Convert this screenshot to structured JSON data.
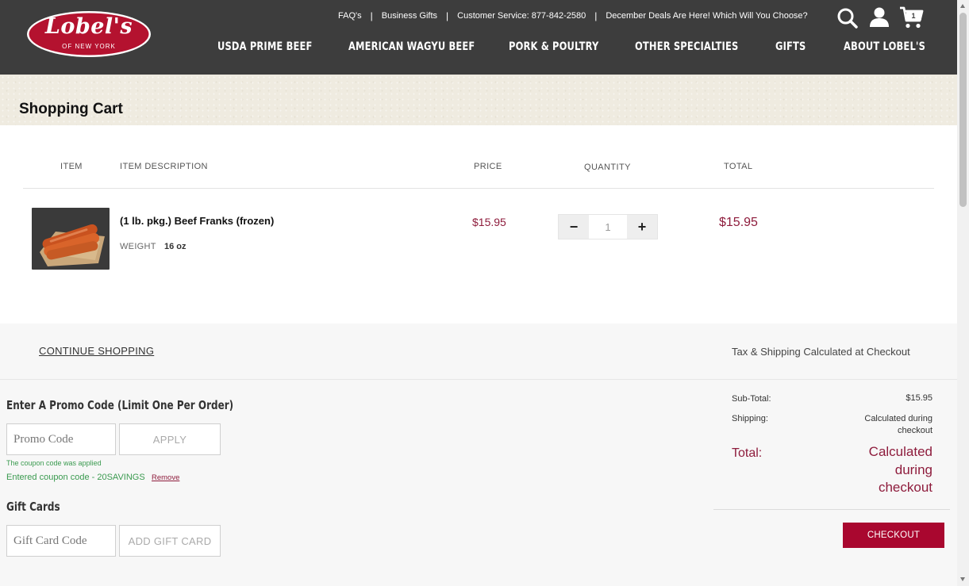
{
  "brand": {
    "logo_main": "Lobel's",
    "logo_sub": "OF NEW YORK",
    "colors": {
      "header_bg": "#3d3d3d",
      "accent": "#a9072f",
      "price": "#8e1c3c",
      "success": "#3a9a4f"
    }
  },
  "top_links": [
    {
      "label": "FAQ's"
    },
    {
      "label": "Business Gifts"
    },
    {
      "label": "Customer Service: 877-842-2580"
    },
    {
      "label": "December Deals Are Here! Which Will You Choose?"
    }
  ],
  "header_icons": [
    "search-icon",
    "account-icon",
    "cart-icon"
  ],
  "cart_count": "1",
  "nav": [
    {
      "label": "USDA PRIME BEEF"
    },
    {
      "label": "AMERICAN WAGYU BEEF"
    },
    {
      "label": "PORK & POULTRY"
    },
    {
      "label": "OTHER SPECIALTIES"
    },
    {
      "label": "GIFTS"
    },
    {
      "label": "ABOUT LOBEL'S"
    }
  ],
  "page_title": "Shopping Cart",
  "table": {
    "headers": {
      "item": "ITEM",
      "description": "ITEM DESCRIPTION",
      "price": "PRICE",
      "quantity": "QUANTITY",
      "total": "TOTAL"
    },
    "rows": [
      {
        "name": "(1 lb. pkg.) Beef Franks (frozen)",
        "weight_label": "WEIGHT",
        "weight_value": "16 oz",
        "price": "$15.95",
        "quantity": "1",
        "total": "$15.95",
        "minus": "−",
        "plus": "+"
      }
    ]
  },
  "continue_shopping": "CONTINUE SHOPPING",
  "tax_note": "Tax & Shipping Calculated at Checkout",
  "promo": {
    "title": "Enter A Promo Code (Limit One Per Order)",
    "placeholder": "Promo Code",
    "apply": "APPLY",
    "applied_msg": "The coupon code was applied",
    "entered_msg": "Entered coupon code - 20SAVINGS",
    "remove": "Remove"
  },
  "gift_cards": {
    "title": "Gift Cards",
    "placeholder": "Gift Card Code",
    "button": "ADD GIFT CARD"
  },
  "summary": {
    "subtotal_label": "Sub-Total:",
    "subtotal_value": "$15.95",
    "shipping_label": "Shipping:",
    "shipping_value": "Calculated during checkout",
    "total_label": "Total:",
    "total_value": "Calculated during checkout",
    "checkout": "CHECKOUT"
  }
}
